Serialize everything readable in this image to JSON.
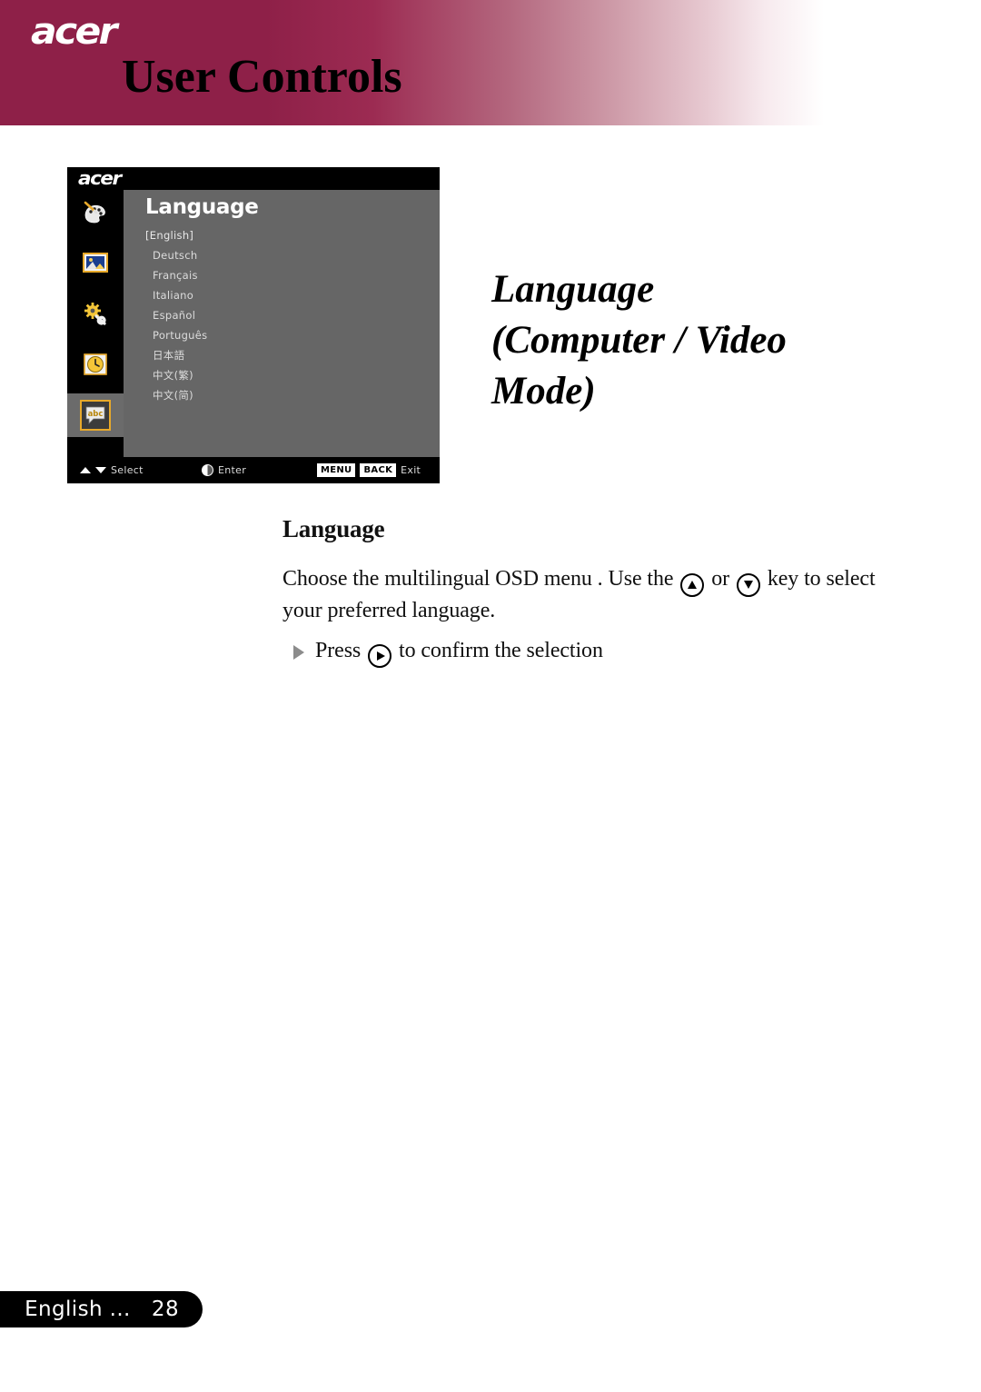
{
  "header": {
    "brand": "acer",
    "title": "User Controls",
    "gradient_start": "#8e2048",
    "gradient_end": "#ffffff"
  },
  "osd": {
    "brand": "acer",
    "menu_title": "Language",
    "sidebar_icons": [
      {
        "name": "color-palette-icon",
        "glyph": "🎨",
        "selected": false
      },
      {
        "name": "image-icon",
        "glyph": "🖼",
        "selected": false
      },
      {
        "name": "gear-wrench-icon",
        "glyph": "⚙",
        "selected": false
      },
      {
        "name": "clock-icon",
        "glyph": "🕑",
        "selected": false
      },
      {
        "name": "language-abc-icon",
        "glyph": "abc",
        "selected": true
      }
    ],
    "languages": [
      {
        "label": "[English]",
        "current": true
      },
      {
        "label": "Deutsch",
        "current": false
      },
      {
        "label": "Français",
        "current": false
      },
      {
        "label": "Italiano",
        "current": false
      },
      {
        "label": "Español",
        "current": false
      },
      {
        "label": "Português",
        "current": false
      },
      {
        "label": "日本語",
        "current": false
      },
      {
        "label": "中文(繁)",
        "current": false
      },
      {
        "label": "中文(简)",
        "current": false
      }
    ],
    "hints": {
      "select_label": "Select",
      "enter_label": "Enter",
      "menu_key": "MENU",
      "back_key": "BACK",
      "exit_label": "Exit"
    },
    "accent_color": "#e8a92a",
    "panel_color": "#666666"
  },
  "section": {
    "heading_line1": "Language",
    "heading_line2": "(Computer / Video",
    "heading_line3": "Mode)"
  },
  "article": {
    "title": "Language",
    "paragraph_part1": "Choose the multilingual OSD menu . Use the",
    "paragraph_part2": "or",
    "paragraph_part3": "key to select your preferred language.",
    "bullet_part1": "Press",
    "bullet_part2": "to confirm the selection"
  },
  "footer": {
    "label": "English ...",
    "page_number": "28"
  }
}
